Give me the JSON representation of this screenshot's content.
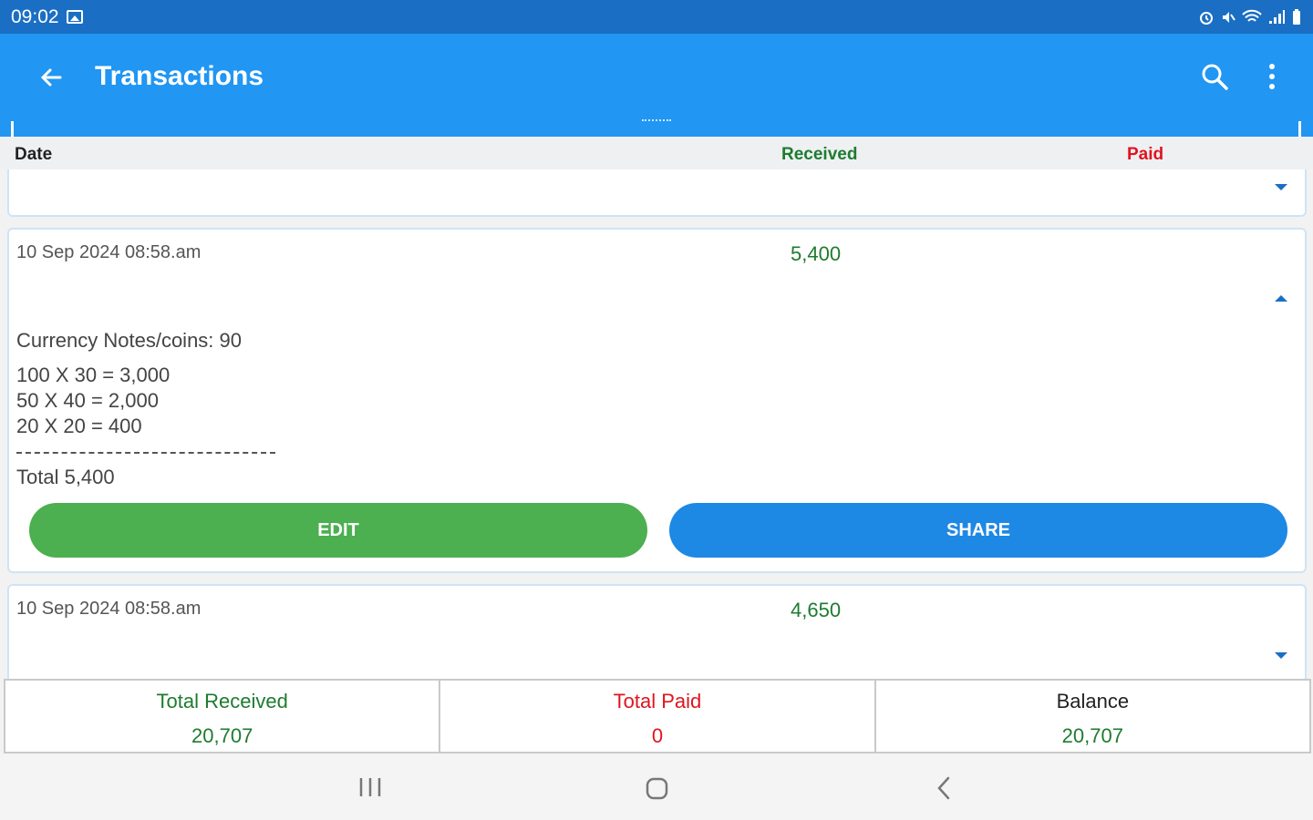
{
  "status_bar": {
    "time": "09:02"
  },
  "app_bar": {
    "title": "Transactions"
  },
  "columns": {
    "date": "Date",
    "received": "Received",
    "paid": "Paid"
  },
  "transactions": [
    {
      "date": "10 Sep 2024 08:58.am",
      "received": "5,400",
      "expanded": true,
      "notes_label": "Currency Notes/coins: 90",
      "lines": [
        "100 X 30 = 3,000",
        "50 X 40 = 2,000",
        "20 X 20 = 400"
      ],
      "separator": "-----------------------------------------",
      "total": "Total 5,400",
      "edit_label": "EDIT",
      "share_label": "SHARE"
    },
    {
      "date": "10 Sep 2024 08:58.am",
      "received": "4,650",
      "expanded": false
    }
  ],
  "summary": {
    "total_received_label": "Total Received",
    "total_received_value": "20,707",
    "total_paid_label": "Total Paid",
    "total_paid_value": "0",
    "balance_label": "Balance",
    "balance_value": "20,707"
  },
  "colors": {
    "status_bar": "#1a6fc4",
    "app_bar": "#2196f3",
    "received": "#1e7b2f",
    "paid": "#e0141e",
    "edit_button": "#4caf50",
    "share_button": "#1e88e5"
  }
}
